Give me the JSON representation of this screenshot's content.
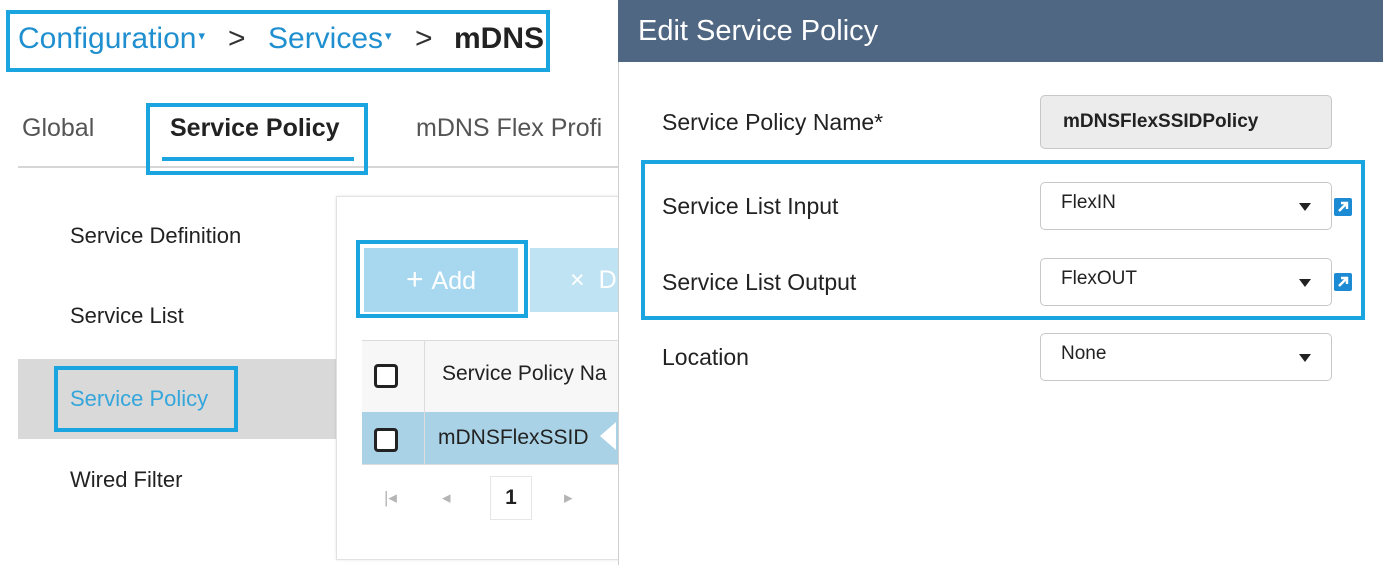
{
  "breadcrumb": {
    "items": [
      {
        "label": "Configuration",
        "dropdown": true
      },
      {
        "label": "Services",
        "dropdown": true
      },
      {
        "label": "mDNS",
        "dropdown": false
      }
    ],
    "separator": ">",
    "caret": "▾"
  },
  "tabs": [
    {
      "label": "Global",
      "active": false
    },
    {
      "label": "Service Policy",
      "active": true
    },
    {
      "label": "mDNS Flex Profi",
      "active": false
    }
  ],
  "left_menu": {
    "items": [
      {
        "label": "Service Definition",
        "active": false
      },
      {
        "label": "Service List",
        "active": false
      },
      {
        "label": "Service Policy",
        "active": true
      },
      {
        "label": "Wired Filter",
        "active": false
      }
    ]
  },
  "toolbar": {
    "add_icon": "plus-icon",
    "add_glyph": "+",
    "add_label": "Add",
    "delete_icon": "close-icon",
    "delete_glyph": "×",
    "delete_label": "D"
  },
  "table": {
    "columns": [
      "Service Policy Na"
    ],
    "rows": [
      {
        "name": "mDNSFlexSSID",
        "selected": true
      }
    ],
    "pagination": {
      "first_icon": "first-page-icon",
      "prev_icon": "prev-page-icon",
      "next_icon": "next-page-icon",
      "first_glyph": "|◂",
      "prev_glyph": "◂",
      "next_glyph": "▸",
      "current_page": "1"
    }
  },
  "dialog": {
    "title": "Edit Service Policy",
    "fields": {
      "name": {
        "label": "Service Policy Name*",
        "value": "mDNSFlexSSIDPolicy"
      },
      "input": {
        "label": "Service List Input",
        "value": "FlexIN"
      },
      "output": {
        "label": "Service List Output",
        "value": "FlexOUT"
      },
      "location": {
        "label": "Location",
        "value": "None"
      }
    }
  },
  "colors": {
    "highlight": "#1aa5e0",
    "header_bg": "#4f6782",
    "link": "#1f8fd0",
    "selected_row": "#a9d2e6",
    "add_button": "#a8d8ef"
  }
}
